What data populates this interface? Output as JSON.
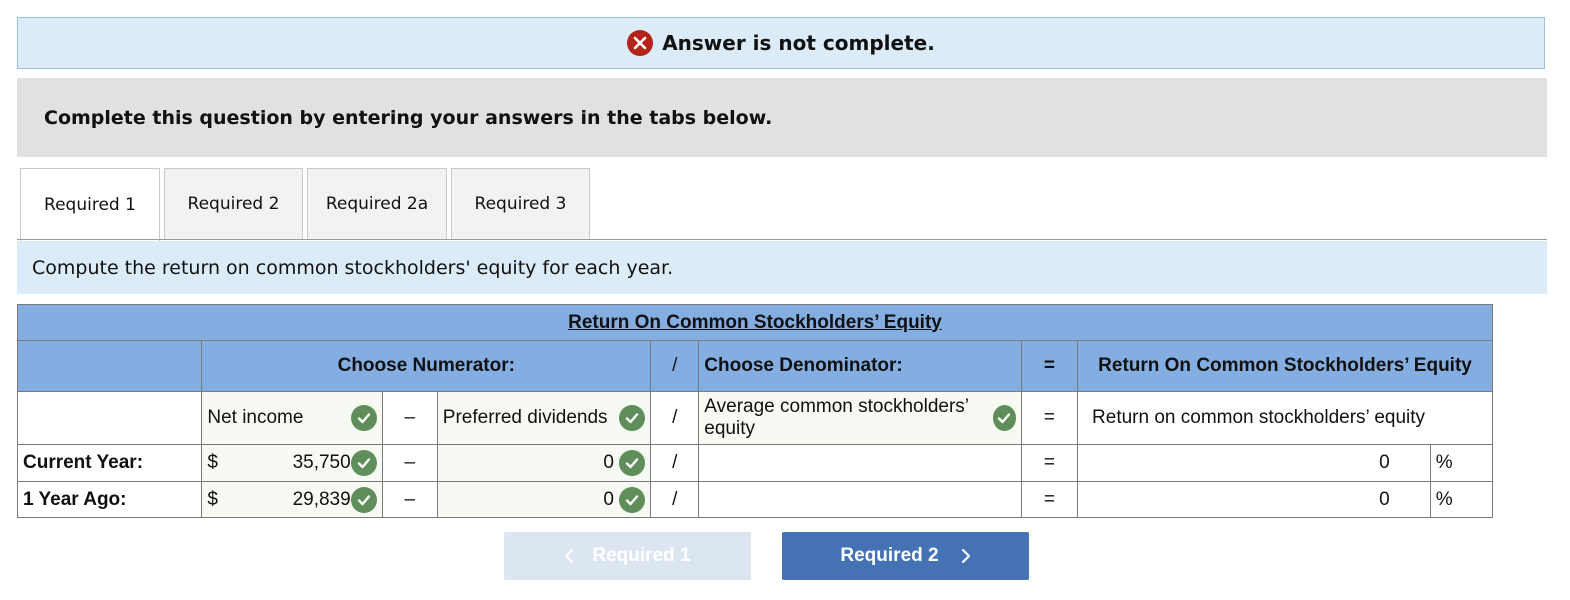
{
  "banner": {
    "text": "Answer is not complete."
  },
  "instruction": "Complete this question by entering your answers in the tabs below.",
  "tabs": [
    {
      "label": "Required 1",
      "active": true
    },
    {
      "label": "Required 2",
      "active": false
    },
    {
      "label": "Required 2a",
      "active": false
    },
    {
      "label": "Required 3",
      "active": false
    }
  ],
  "question": "Compute the return on common stockholders' equity for each year.",
  "table": {
    "title": "Return On Common Stockholders’ Equity",
    "numerator_header": "Choose Numerator:",
    "slash": "/",
    "denominator_header": "Choose Denominator:",
    "equals": "=",
    "result_header": "Return On Common Stockholders’ Equity",
    "label_row": {
      "num1": "Net income",
      "minus": "–",
      "num2": "Preferred dividends",
      "denominator": "Average common stockholders’ equity",
      "result": "Return on common stockholders’ equity"
    },
    "rows": [
      {
        "label": "Current Year:",
        "currency": "$",
        "net_income": "35,750",
        "minus": "–",
        "preferred": "0",
        "denominator": "",
        "result": "0",
        "percent": "%"
      },
      {
        "label": "1 Year Ago:",
        "currency": "$",
        "net_income": "29,839",
        "minus": "–",
        "preferred": "0",
        "denominator": "",
        "result": "0",
        "percent": "%"
      }
    ]
  },
  "nav": {
    "prev_label": "Required 1",
    "next_label": "Required 2"
  },
  "colors": {
    "header_blue": "#84aee2",
    "banner_bg": "#dcebf8",
    "error_red": "#b42318",
    "check_green": "#5f8e5b",
    "next_button": "#4472b4"
  }
}
